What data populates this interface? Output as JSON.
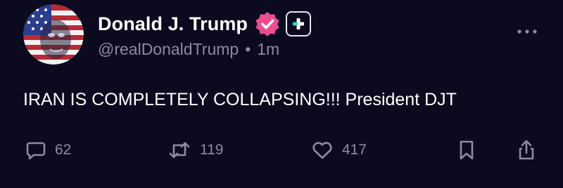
{
  "author": {
    "display_name": "Donald J. Trump",
    "handle": "@realDonaldTrump",
    "separator": "•",
    "time_ago": "1m",
    "avatar_icon": "flag-portrait-avatar",
    "verified_icon": "verified-badge-icon",
    "plus_icon": "plus-badge-icon"
  },
  "post": {
    "text": "IRAN IS COMPLETELY COLLAPSING!!! President DJT"
  },
  "actions": {
    "reply_count": "62",
    "repost_count": "119",
    "like_count": "417"
  },
  "colors": {
    "background": "#0b0a1f",
    "verified": "#ec4d8f",
    "plus_accent": "#2fd6c6",
    "muted": "#8d8b9e"
  }
}
